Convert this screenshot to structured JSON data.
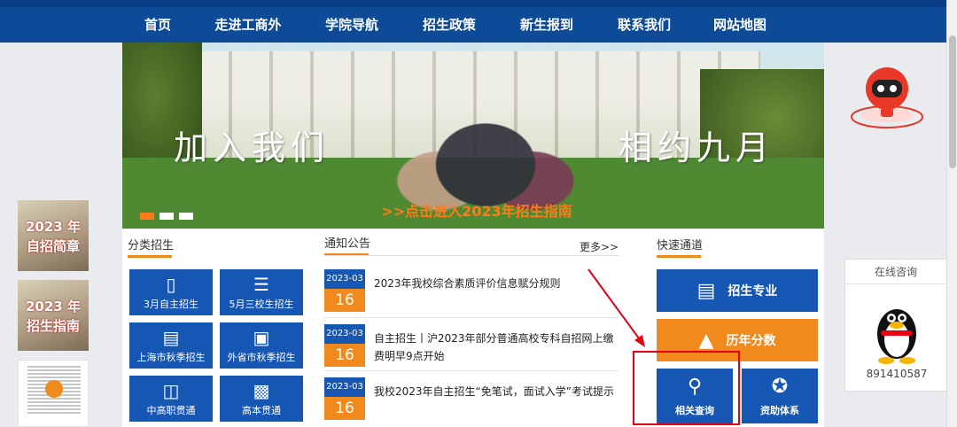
{
  "nav": {
    "items": [
      "首页",
      "走进工商外",
      "学院导航",
      "招生政策",
      "新生报到",
      "联系我们",
      "网站地图"
    ]
  },
  "banner": {
    "slogan_left": "加入我们",
    "slogan_right": "相约九月",
    "guide_link": ">>点击进入2023年招生指南"
  },
  "categories": {
    "title": "分类招生",
    "items": [
      {
        "label": "3月自主招生",
        "icon": "book-icon"
      },
      {
        "label": "5月三校生招生",
        "icon": "books-icon"
      },
      {
        "label": "上海市秋季招生",
        "icon": "document-icon"
      },
      {
        "label": "外省市秋季招生",
        "icon": "open-book-icon"
      },
      {
        "label": "中高职贯通",
        "icon": "open-book-icon"
      },
      {
        "label": "高本贯通",
        "icon": "id-card-icon"
      }
    ]
  },
  "news": {
    "title": "通知公告",
    "more": "更多>>",
    "items": [
      {
        "ym": "2023-03",
        "day": "16",
        "text": "2023年我校综合素质评价信息赋分规则"
      },
      {
        "ym": "2023-03",
        "day": "16",
        "text": "自主招生丨沪2023年部分普通高校专科自招网上缴费明早9点开始"
      },
      {
        "ym": "2023-03",
        "day": "16",
        "text": "我校2023年自主招生“免笔试，面试入学”考试提示"
      }
    ]
  },
  "quick": {
    "title": "快速通道",
    "major": "招生专业",
    "scores": "历年分数",
    "query": "相关查询",
    "aid": "资助体系"
  },
  "float_left": {
    "card1": {
      "line1": "2023 年",
      "line2": "自招简章"
    },
    "card2": {
      "line1": "2023 年",
      "line2": "招生指南"
    }
  },
  "consult": {
    "title": "在线咨询",
    "number": "891410587"
  },
  "colors": {
    "nav": "#0d4a97",
    "blue_button": "#1657b3",
    "orange": "#f08a1c",
    "highlight": "#e60012"
  }
}
